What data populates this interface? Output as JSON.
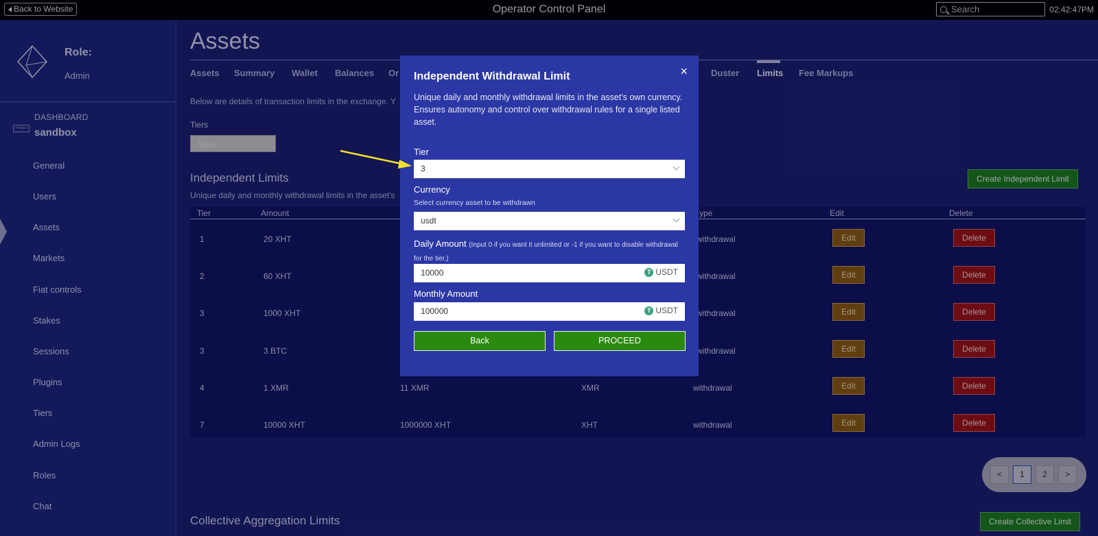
{
  "topbar": {
    "back_label": "Back to Website",
    "title": "Operator Control Panel",
    "search_placeholder": "Search",
    "clock": "02:42:47PM"
  },
  "sidebar": {
    "role_label": "Role:",
    "role_value": "Admin",
    "dashboard_label": "DASHBOARD",
    "dashboard_sub": "sandbox",
    "mini_logo": "HollaEx",
    "items": [
      {
        "label": "General"
      },
      {
        "label": "Users"
      },
      {
        "label": "Assets"
      },
      {
        "label": "Markets"
      },
      {
        "label": "Fiat controls"
      },
      {
        "label": "Stakes"
      },
      {
        "label": "Sessions"
      },
      {
        "label": "Plugins"
      },
      {
        "label": "Tiers"
      },
      {
        "label": "Admin Logs"
      },
      {
        "label": "Roles"
      },
      {
        "label": "Chat"
      }
    ]
  },
  "main": {
    "title": "Assets",
    "tabs": [
      {
        "label": "Assets"
      },
      {
        "label": "Summary"
      },
      {
        "label": "Wallet"
      },
      {
        "label": "Balances"
      },
      {
        "label": "Or"
      },
      {
        "label": "Duster"
      },
      {
        "label": "Limits"
      },
      {
        "label": "Fee Markups"
      }
    ],
    "description": "Below are details of transaction limits in the exchange. Y",
    "tiers_label": "Tiers",
    "tiers_placeholder": "Tiers",
    "independent": {
      "title": "Independent Limits",
      "description": "Unique daily and monthly withdrawal limits in the asset's",
      "create_label": "Create Independent Limit"
    },
    "table": {
      "headers": [
        "Tier",
        "Amount",
        "ype",
        "Edit",
        "Delete"
      ],
      "rows": [
        {
          "tier": "1",
          "amount": "20 XHT",
          "monthly": "",
          "currency": "",
          "type": "withdrawal"
        },
        {
          "tier": "2",
          "amount": "60 XHT",
          "monthly": "",
          "currency": "",
          "type": "withdrawal"
        },
        {
          "tier": "3",
          "amount": "1000 XHT",
          "monthly": "",
          "currency": "",
          "type": "withdrawal"
        },
        {
          "tier": "3",
          "amount": "3 BTC",
          "monthly": "",
          "currency": "",
          "type": "withdrawal"
        },
        {
          "tier": "4",
          "amount": "1 XMR",
          "monthly": "11 XMR",
          "currency": "XMR",
          "type": "withdrawal"
        },
        {
          "tier": "7",
          "amount": "10000 XHT",
          "monthly": "1000000 XHT",
          "currency": "XHT",
          "type": "withdrawal"
        }
      ],
      "edit_label": "Edit",
      "delete_label": "Delete"
    },
    "pagination": {
      "prev": "<",
      "pages": [
        "1",
        "2"
      ],
      "next": ">",
      "current": "1"
    },
    "collective": {
      "title": "Collective Aggregation Limits",
      "create_label": "Create Collective Limit"
    }
  },
  "modal": {
    "title": "Independent Withdrawal Limit",
    "close": "×",
    "description": "Unique daily and monthly withdrawal limits in the asset's own currency. Ensures autonomy and control over withdrawal rules for a single listed asset.",
    "tier_label": "Tier",
    "tier_value": "3",
    "currency_label": "Currency",
    "currency_sub": "Select currency asset to be withdrawn",
    "currency_value": "usdt",
    "daily_label": "Daily Amount",
    "daily_hint": "(Input 0 if you want it unlimited or -1 if you want to disable withdrawal for the tier.)",
    "daily_value": "10000",
    "monthly_label": "Monthly Amount",
    "monthly_value": "100000",
    "unit": "USDT",
    "tether_glyph": "T",
    "back_label": "Back",
    "proceed_label": "PROCEED"
  },
  "colors": {
    "accent_green": "#2a8a0f",
    "modal_bg": "#2b37a4",
    "page_bg": "#1a1f6e",
    "edit_orange": "#8a5a0e",
    "delete_red": "#9c1414",
    "arrow_yellow": "#f5e12a"
  }
}
